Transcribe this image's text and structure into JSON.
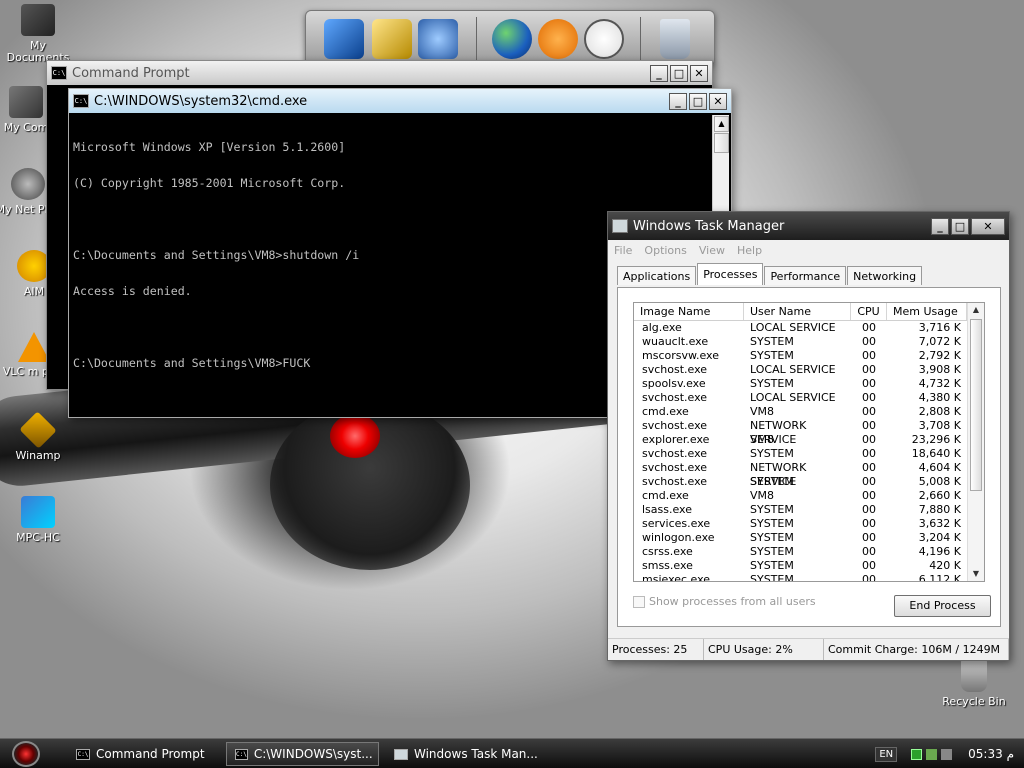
{
  "desktop": {
    "icons": [
      {
        "label": "My Documents"
      },
      {
        "label": "My Com"
      },
      {
        "label": "My Net Plac"
      },
      {
        "label": "AIM"
      },
      {
        "label": "VLC m play"
      },
      {
        "label": "Winamp"
      },
      {
        "label": "MPC-HC"
      },
      {
        "label": "Recycle Bin"
      }
    ]
  },
  "dock": {
    "items": [
      "computer-icon",
      "folder-icon",
      "settings-icon",
      "globe-icon",
      "media-player-icon",
      "clock-icon",
      "trash-icon"
    ]
  },
  "cmd_back": {
    "title": "Command Prompt",
    "icon_text": "C:\\"
  },
  "cmd_front": {
    "title": "C:\\WINDOWS\\system32\\cmd.exe",
    "icon_text": "C:\\",
    "lines": [
      "Microsoft Windows XP [Version 5.1.2600]",
      "(C) Copyright 1985-2001 Microsoft Corp.",
      "C:\\Documents and Settings\\VM8>shutdown /i",
      "Access is denied.",
      "C:\\Documents and Settings\\VM8>FUCK"
    ]
  },
  "taskmgr": {
    "title": "Windows Task Manager",
    "menu": [
      "File",
      "Options",
      "View",
      "Help"
    ],
    "tabs": [
      "Applications",
      "Processes",
      "Performance",
      "Networking"
    ],
    "columns": [
      "Image Name",
      "User Name",
      "CPU",
      "Mem Usage"
    ],
    "processes": [
      [
        "alg.exe",
        "LOCAL SERVICE",
        "00",
        "3,716 K"
      ],
      [
        "wuauclt.exe",
        "SYSTEM",
        "00",
        "7,072 K"
      ],
      [
        "mscorsvw.exe",
        "SYSTEM",
        "00",
        "2,792 K"
      ],
      [
        "svchost.exe",
        "LOCAL SERVICE",
        "00",
        "3,908 K"
      ],
      [
        "spoolsv.exe",
        "SYSTEM",
        "00",
        "4,732 K"
      ],
      [
        "svchost.exe",
        "LOCAL SERVICE",
        "00",
        "4,380 K"
      ],
      [
        "cmd.exe",
        "VM8",
        "00",
        "2,808 K"
      ],
      [
        "svchost.exe",
        "NETWORK SERVICE",
        "00",
        "3,708 K"
      ],
      [
        "explorer.exe",
        "VM8",
        "00",
        "23,296 K"
      ],
      [
        "svchost.exe",
        "SYSTEM",
        "00",
        "18,640 K"
      ],
      [
        "svchost.exe",
        "NETWORK SERVICE",
        "00",
        "4,604 K"
      ],
      [
        "svchost.exe",
        "SYSTEM",
        "00",
        "5,008 K"
      ],
      [
        "cmd.exe",
        "VM8",
        "00",
        "2,660 K"
      ],
      [
        "lsass.exe",
        "SYSTEM",
        "00",
        "7,880 K"
      ],
      [
        "services.exe",
        "SYSTEM",
        "00",
        "3,632 K"
      ],
      [
        "winlogon.exe",
        "SYSTEM",
        "00",
        "3,204 K"
      ],
      [
        "csrss.exe",
        "SYSTEM",
        "00",
        "4,196 K"
      ],
      [
        "smss.exe",
        "SYSTEM",
        "00",
        "420 K"
      ],
      [
        "msiexec.exe",
        "SYSTEM",
        "00",
        "6,112 K"
      ]
    ],
    "show_all_label": "Show processes from all users",
    "end_process_label": "End Process",
    "status": {
      "processes": "Processes: 25",
      "cpu": "CPU Usage: 2%",
      "commit": "Commit Charge: 106M / 1249M"
    }
  },
  "taskbar": {
    "buttons": [
      {
        "label": "Command Prompt",
        "icon_text": "C:\\"
      },
      {
        "label": "C:\\WINDOWS\\syst...",
        "icon_text": "C:\\"
      },
      {
        "label": "Windows Task Man..."
      }
    ],
    "language": "EN",
    "clock": "05:33 م"
  },
  "colors": {
    "cmd_text": "#c0c0c0",
    "taskmgr_title": "#1e1e1e",
    "cmd_front_title": "#b9d9ef"
  }
}
